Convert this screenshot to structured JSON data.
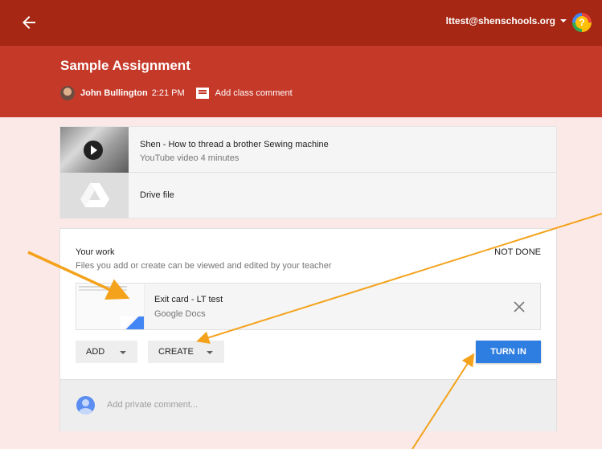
{
  "topbar": {
    "account_email": "lttest@shenschools.org",
    "help_label": "?",
    "color": "#a52714"
  },
  "assignment": {
    "title": "Sample Assignment",
    "author": "John Bullington",
    "time": "2:21 PM",
    "add_comment_label": "Add class comment",
    "header_color": "#c53929"
  },
  "materials": [
    {
      "title": "Shen - How to thread a brother Sewing machine",
      "subtitle": "YouTube video  4 minutes",
      "icon": "play-icon"
    },
    {
      "title": "Drive file",
      "icon": "google-drive-icon"
    }
  ],
  "your_work": {
    "label": "Your work",
    "description": "Files you add or create can be viewed and edited by your teacher",
    "status": "NOT DONE",
    "attachment": {
      "title": "Exit card - LT test",
      "subtitle": "Google Docs",
      "icon": "google-docs-icon"
    },
    "add_label": "ADD",
    "create_label": "CREATE",
    "turn_in_label": "TURN IN",
    "turn_in_color": "#2e7de1",
    "private_comment_placeholder": "Add private comment..."
  },
  "annotations": {
    "arrow_color": "#f4a21b"
  }
}
